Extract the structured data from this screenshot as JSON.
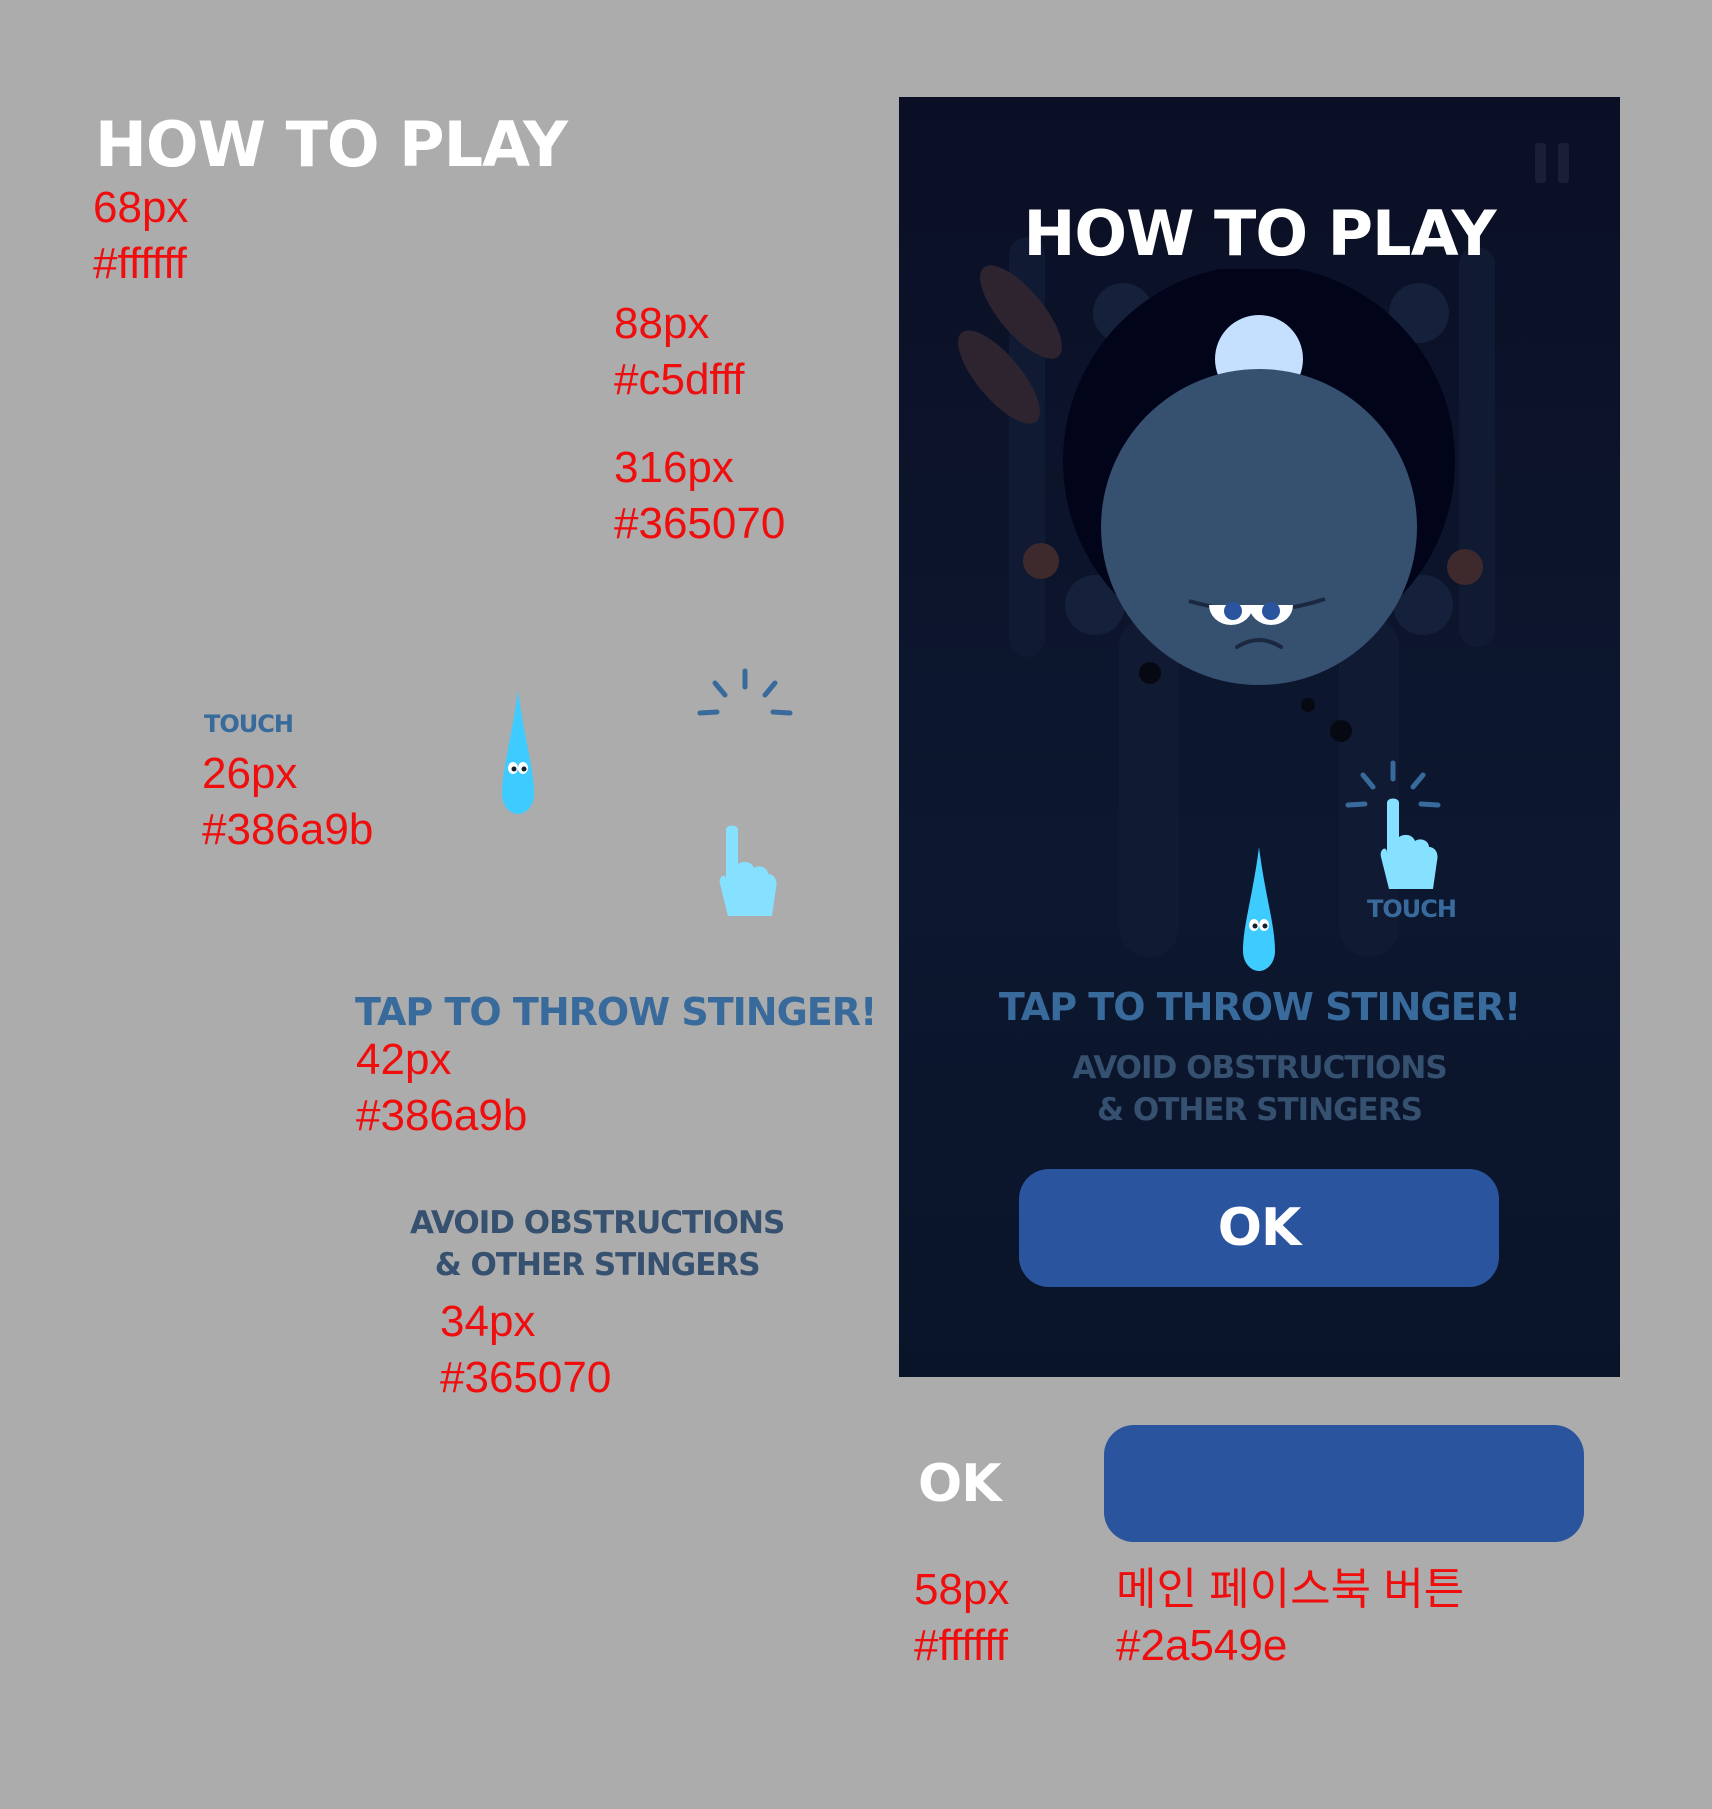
{
  "spec": {
    "title": {
      "text": "HOW TO PLAY",
      "size": "68px",
      "color": "#ffffff"
    },
    "circle": {
      "size": "88px",
      "color": "#c5dfff"
    },
    "planet": {
      "size": "316px",
      "color": "#365070"
    },
    "touch": {
      "text": "TOUCH",
      "size": "26px",
      "color": "#386a9b"
    },
    "tap": {
      "text": "TAP TO THROW STINGER!",
      "size": "42px",
      "color": "#386a9b"
    },
    "avoid": {
      "line1": "AVOID OBSTRUCTIONS",
      "line2": "& OTHER STINGERS",
      "size": "34px",
      "color": "#365070"
    },
    "ok": {
      "text": "OK",
      "size": "58px",
      "color": "#ffffff"
    },
    "button": {
      "label": "메인 페이스북 버튼",
      "color": "#2a549e"
    }
  },
  "game": {
    "title": "HOW TO PLAY",
    "touch_label": "TOUCH",
    "tap_label": "TAP TO THROW STINGER!",
    "avoid_line1": "AVOID OBSTRUCTIONS",
    "avoid_line2": "& OTHER STINGERS",
    "ok_label": "OK"
  },
  "icons": [
    "pause-icon",
    "stinger-icon",
    "touch-hand-icon",
    "planet-face-icon"
  ]
}
